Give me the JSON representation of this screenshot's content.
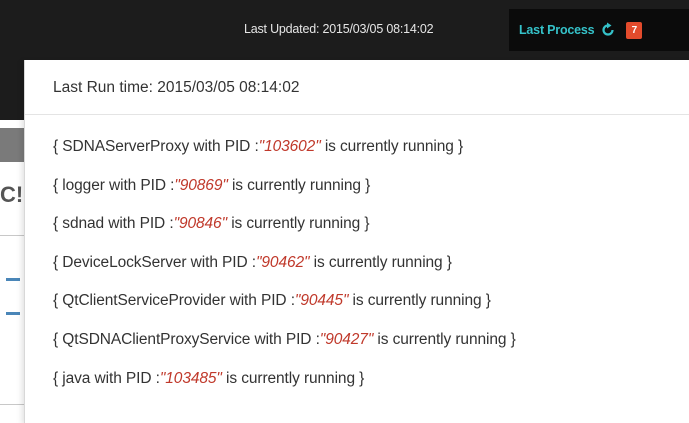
{
  "topbar": {
    "last_updated": "Last Updated: 2015/03/05 08:14:02",
    "last_process_label": "Last Process",
    "badge_count": "7"
  },
  "background": {
    "partial_char": "C!"
  },
  "dropdown": {
    "last_run_time": "Last Run time: 2015/03/05 08:14:02",
    "processes": [
      {
        "name": "SDNAServerProxy",
        "pid": "103602"
      },
      {
        "name": "logger",
        "pid": "90869"
      },
      {
        "name": "sdnad",
        "pid": "90846"
      },
      {
        "name": "DeviceLockServer",
        "pid": "90462"
      },
      {
        "name": "QtClientServiceProvider",
        "pid": "90445"
      },
      {
        "name": "QtSDNAClientProxyService",
        "pid": "90427"
      },
      {
        "name": "java",
        "pid": "103485"
      }
    ],
    "text_prefix": "{ ",
    "text_with_pid": " with PID :",
    "text_suffix": " is currently running }"
  },
  "colors": {
    "accent": "#35c2c9",
    "badge": "#e34b2c",
    "pid": "#c0392b"
  },
  "icons": {
    "refresh": "refresh-icon"
  }
}
